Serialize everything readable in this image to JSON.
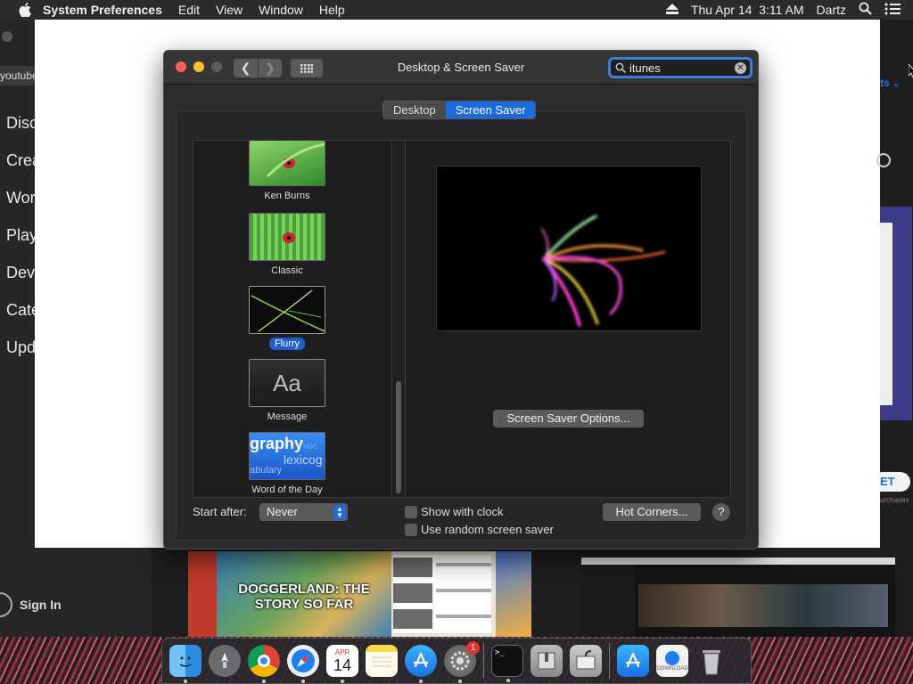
{
  "menubar": {
    "app_name": "System Preferences",
    "menus": [
      "Edit",
      "View",
      "Window",
      "Help"
    ],
    "datetime": "Thu Apr 14  3:11 AM",
    "user": "Dartz"
  },
  "background_app": {
    "search_chip": "youtube",
    "nav_items": [
      "Discover",
      "Create",
      "Work",
      "Play",
      "Develop",
      "Categories",
      "Updates"
    ],
    "sign_in": "Sign In",
    "link_partial": "ts",
    "get_button": "ET",
    "tiny_text": "urchases",
    "thumb_title": "DOGGERLAND: THE STORY SO FAR"
  },
  "window": {
    "title": "Desktop & Screen Saver",
    "search_value": "itunes",
    "tabs": [
      {
        "label": "Desktop",
        "active": false
      },
      {
        "label": "Screen Saver",
        "active": true
      }
    ],
    "screen_savers": [
      {
        "name": "Ken Burns",
        "selected": false
      },
      {
        "name": "Classic",
        "selected": false
      },
      {
        "name": "Flurry",
        "selected": true
      },
      {
        "name": "Message",
        "selected": false
      },
      {
        "name": "Word of the Day",
        "selected": false
      }
    ],
    "message_thumb_text": "Aa",
    "word_thumb_words": [
      "graphy",
      "lexicog",
      "abulary",
      "voc"
    ],
    "options_button": "Screen Saver Options...",
    "start_after_label": "Start after:",
    "start_after_value": "Never",
    "show_clock_label": "Show with clock",
    "random_label": "Use random screen saver",
    "hot_corners_button": "Hot Corners...",
    "help_label": "?"
  },
  "dock": {
    "calendar_month": "APR",
    "calendar_day": "14",
    "settings_badge": "1",
    "terminal_prompt": ">_",
    "download_label": "DOWNLOAD"
  },
  "colors": {
    "accent": "#1c6ce0",
    "window_bg": "#2c2c2e"
  }
}
